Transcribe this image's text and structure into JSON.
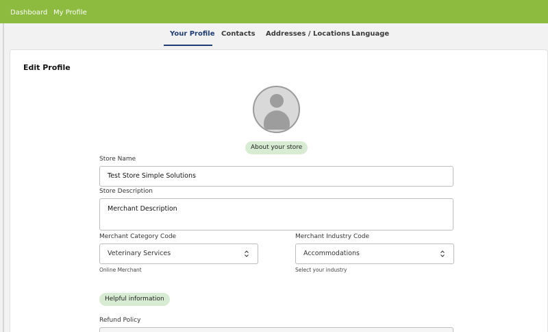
{
  "breadcrumb": {
    "home": "Dashboard",
    "current": "My Profile"
  },
  "tabs": [
    {
      "label": "Your Profile",
      "active": true
    },
    {
      "label": "Contacts",
      "active": false
    },
    {
      "label": "Addresses / Locations",
      "active": false
    },
    {
      "label": "Language",
      "active": false
    }
  ],
  "form": {
    "title": "Edit Profile",
    "about_section": "About your store",
    "store_name": {
      "label": "Store Name",
      "value": "Test Store Simple Solutions"
    },
    "store_description": {
      "label": "Store Description",
      "value": "Merchant Description"
    },
    "category_code": {
      "label": "Merchant Category Code",
      "value": "Veterinary Services",
      "hint": "Online Merchant"
    },
    "industry_code": {
      "label": "Merchant Industry Code",
      "value": "Accommodations",
      "hint": "Select your industry"
    },
    "helpful_section": "Helpful information",
    "refund_policy": {
      "label": "Refund Policy"
    }
  },
  "colors": {
    "topbar": "#8dbb3f",
    "accent": "#1f3b73",
    "pill": "#d7ecd3"
  },
  "icons": {
    "avatar": "user-avatar-icon",
    "select": "chevron-up-down-icon"
  }
}
